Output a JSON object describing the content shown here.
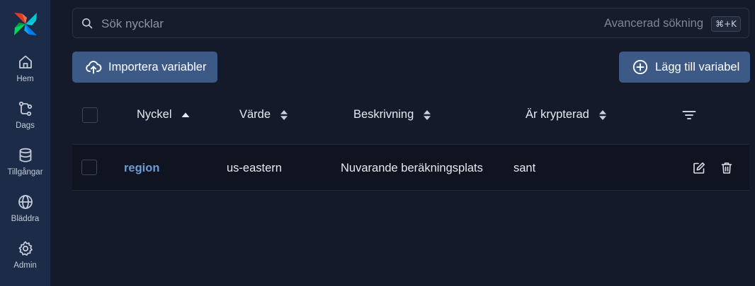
{
  "search": {
    "placeholder": "Sök nycklar",
    "advanced_label": "Avancerad sökning",
    "shortcut": "⌘+K"
  },
  "sidebar": {
    "items": [
      {
        "label": "Hem",
        "icon": "home-icon"
      },
      {
        "label": "Dags",
        "icon": "dags-icon"
      },
      {
        "label": "Tillgångar",
        "icon": "database-icon"
      },
      {
        "label": "Bläddra",
        "icon": "globe-icon"
      },
      {
        "label": "Admin",
        "icon": "gear-icon"
      }
    ]
  },
  "toolbar": {
    "import_label": "Importera variabler",
    "add_label": "Lägg till variabel"
  },
  "table": {
    "columns": [
      "Nyckel",
      "Värde",
      "Beskrivning",
      "Är krypterad"
    ],
    "rows": [
      {
        "key": "region",
        "value": "us-eastern",
        "description": "Nuvarande beräkningsplats",
        "encrypted": "sant"
      }
    ]
  },
  "colors": {
    "sidebar_bg": "#1c2b47",
    "page_bg": "#141a29",
    "button_bg": "#3c5a85",
    "link": "#6e9bd1"
  }
}
